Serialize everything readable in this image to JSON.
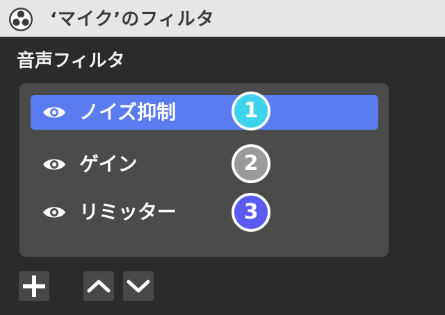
{
  "window": {
    "title": "‘マイク’のフィルタ",
    "logo_icon": "obs-logo-icon"
  },
  "section": {
    "label": "音声フィルタ"
  },
  "filters": [
    {
      "label": "ノイズ抑制",
      "selected": true,
      "icon": "eye-icon",
      "badge": "1",
      "badge_color": "#3ed3ec"
    },
    {
      "label": "ゲイン",
      "selected": false,
      "icon": "eye-icon",
      "badge": "2",
      "badge_color": "#9a9a9a"
    },
    {
      "label": "リミッター",
      "selected": false,
      "icon": "eye-icon",
      "badge": "3",
      "badge_color": "#5b5bf2"
    }
  ],
  "toolbar": {
    "add_icon": "plus-icon",
    "up_icon": "chevron-up-icon",
    "down_icon": "chevron-down-icon"
  },
  "colors": {
    "background": "#2b2b2b",
    "panel": "#4b4b4b",
    "selection": "#5b7cf0",
    "titlebar": "#e6e6e6"
  }
}
